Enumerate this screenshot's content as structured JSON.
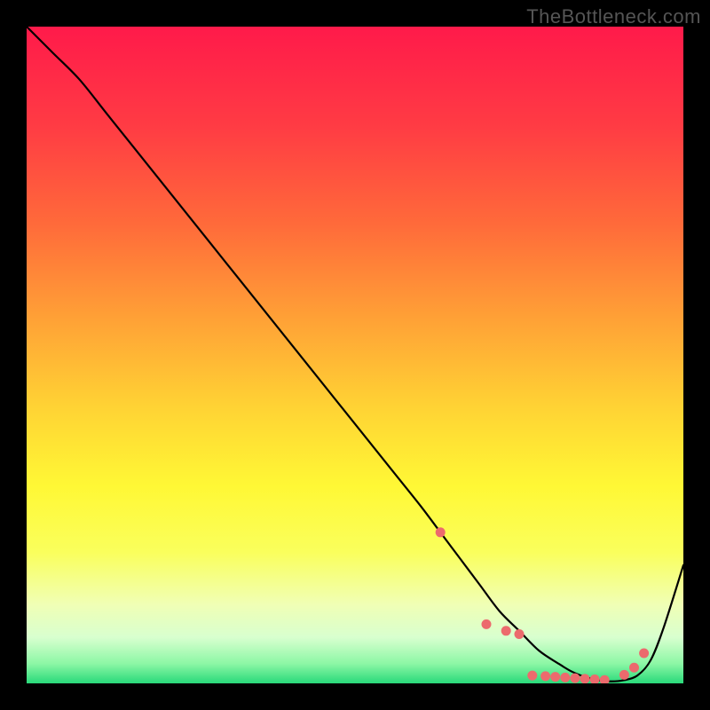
{
  "watermark": "TheBottleneck.com",
  "chart_data": {
    "type": "line",
    "title": "",
    "xlabel": "",
    "ylabel": "",
    "xlim": [
      0,
      100
    ],
    "ylim": [
      0,
      100
    ],
    "background_gradient": {
      "stops": [
        {
          "offset": 0,
          "color": "#ff1a4a"
        },
        {
          "offset": 15,
          "color": "#ff3b44"
        },
        {
          "offset": 30,
          "color": "#ff6a3a"
        },
        {
          "offset": 45,
          "color": "#ffa336"
        },
        {
          "offset": 58,
          "color": "#ffd334"
        },
        {
          "offset": 70,
          "color": "#fff835"
        },
        {
          "offset": 80,
          "color": "#faff5c"
        },
        {
          "offset": 88,
          "color": "#f0ffb5"
        },
        {
          "offset": 93,
          "color": "#d8ffcf"
        },
        {
          "offset": 97,
          "color": "#8cf7a5"
        },
        {
          "offset": 100,
          "color": "#29d97a"
        }
      ]
    },
    "series": [
      {
        "name": "bottleneck-curve",
        "color": "#000000",
        "width": 2.2,
        "x": [
          0,
          4,
          8,
          12,
          16,
          20,
          24,
          28,
          32,
          36,
          40,
          44,
          48,
          52,
          56,
          60,
          63,
          66,
          69,
          72,
          75,
          78,
          81,
          83,
          85,
          87,
          89,
          91,
          93,
          95,
          97,
          100
        ],
        "y": [
          100,
          96,
          92,
          87,
          82,
          77,
          72,
          67,
          62,
          57,
          52,
          47,
          42,
          37,
          32,
          27,
          23,
          19,
          15,
          11,
          8,
          5,
          3,
          1.8,
          1.0,
          0.5,
          0.3,
          0.5,
          1.2,
          3.5,
          8.5,
          18
        ]
      }
    ],
    "markers": {
      "name": "highlight-points",
      "color": "#ec6a6d",
      "radius": 5.5,
      "x": [
        63,
        70,
        73,
        75,
        77,
        79,
        80.5,
        82,
        83.5,
        85,
        86.5,
        88,
        91,
        92.5,
        94
      ],
      "y": [
        23,
        9,
        8,
        7.5,
        1.2,
        1.1,
        1.0,
        0.9,
        0.8,
        0.7,
        0.6,
        0.5,
        1.3,
        2.4,
        4.6
      ]
    }
  }
}
